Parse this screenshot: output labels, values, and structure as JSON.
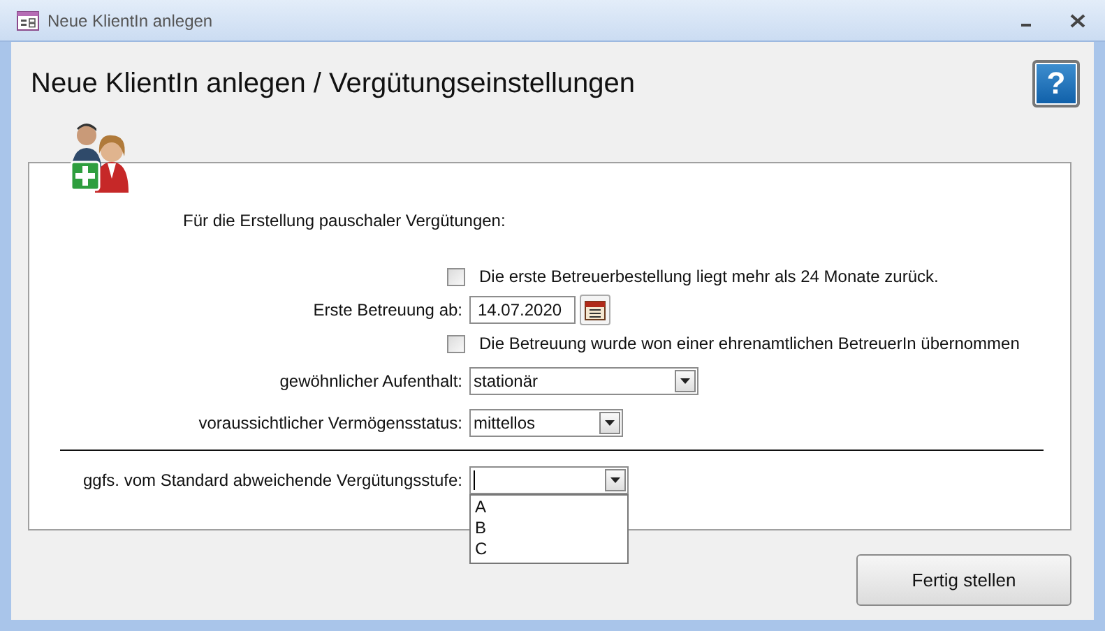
{
  "window": {
    "title": "Neue KlientIn anlegen"
  },
  "heading": "Neue KlientIn anlegen / Vergütungseinstellungen",
  "help_button": "?",
  "intro": "Für die Erstellung pauschaler Vergütungen:",
  "rows": [
    {
      "kind": "checkbox",
      "label": "Die erste Betreuerbestellung liegt mehr als 24 Monate zurück.",
      "checked": false
    },
    {
      "kind": "date",
      "label": "Erste Betreuung ab:",
      "value": "14.07.2020"
    },
    {
      "kind": "checkbox",
      "label": "Die Betreuung wurde won einer ehrenamtlichen BetreuerIn übernommen",
      "checked": false
    },
    {
      "kind": "select",
      "label": "gewöhnlicher Aufenthalt:",
      "value": "stationär"
    },
    {
      "kind": "select",
      "label": "voraussichtlicher Vermögensstatus:",
      "value": "mittellos"
    },
    {
      "kind": "separator"
    },
    {
      "kind": "select",
      "label": "ggfs. vom Standard abweichende Vergütungsstufe:",
      "expanded": true,
      "options": [
        "A",
        "B",
        "C"
      ]
    }
  ],
  "button": "Fertig stellen"
}
